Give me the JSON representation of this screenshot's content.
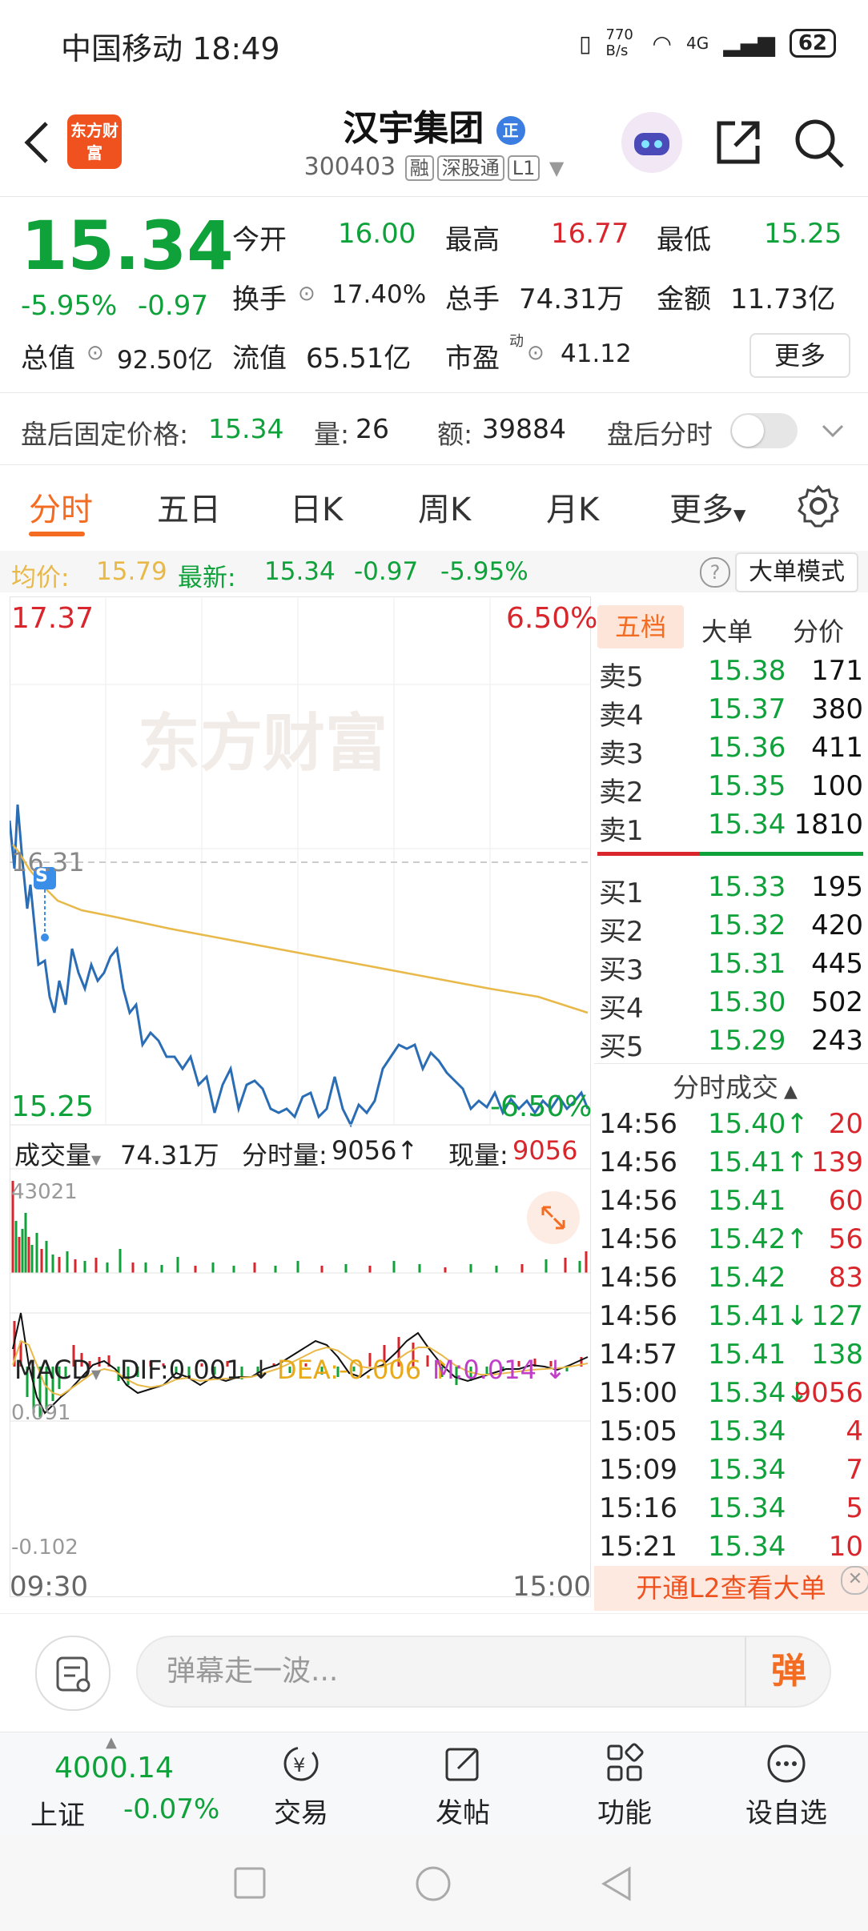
{
  "status_bar": {
    "carrier_time": "中国移动 18:49",
    "net_speed": "770 B/s",
    "network": "4G",
    "battery": "62"
  },
  "header": {
    "app_logo_text": "东方财富",
    "stock_name": "汉宇集团",
    "name_badge": "正",
    "stock_code": "300403",
    "tags": [
      "融",
      "深股通",
      "L1"
    ]
  },
  "quote": {
    "price": "15.34",
    "change_pct": "-5.95%",
    "change": "-0.97",
    "open_label": "今开",
    "open": "16.00",
    "high_label": "最高",
    "high": "16.77",
    "low_label": "最低",
    "low": "15.25",
    "turnover_label": "换手",
    "turnover": "17.40%",
    "volume_label": "总手",
    "volume": "74.31万",
    "amount_label": "金额",
    "amount": "11.73亿",
    "total_value_label": "总值",
    "total_value": "92.50亿",
    "float_value_label": "流值",
    "float_value": "65.51亿",
    "pe_label": "市盈",
    "pe_sup": "动",
    "pe": "41.12",
    "more_button": "更多"
  },
  "after_hours": {
    "price_label": "盘后固定价格:",
    "price": "15.34",
    "volume_label": "量:",
    "volume": "26",
    "amount_label": "额:",
    "amount": "39884",
    "timeshare_label": "盘后分时"
  },
  "tabs": [
    "分时",
    "五日",
    "日K",
    "周K",
    "月K",
    "更多"
  ],
  "info_bar": {
    "avg_label": "均价:",
    "avg": "15.79",
    "latest_label": "最新:",
    "latest": "15.34",
    "change": "-0.97",
    "change_pct": "-5.95%",
    "big_order_mode": "大单模式"
  },
  "price_chart": {
    "top_price": "17.37",
    "top_pct": "6.50%",
    "bottom_price": "15.25",
    "bottom_pct": "-6.50%",
    "ref_price": "16.31",
    "marker": "S",
    "watermark": "东方财富"
  },
  "volume_bar": {
    "label": "成交量",
    "total": "74.31万",
    "tick_label": "分时量:",
    "tick_value": "9056↑",
    "current_label": "现量:",
    "current_value": "9056",
    "max": "43021"
  },
  "macd_bar": {
    "label": "MACD",
    "dif": "DIF:0.001 ↓",
    "dea": "DEA:-0.006 ↑",
    "m": "M:0.014 ↓",
    "top": "0.091",
    "bottom": "-0.102"
  },
  "time_axis": {
    "start": "09:30",
    "end": "15:00"
  },
  "order_book": {
    "tabs": [
      "五档",
      "大单",
      "分价"
    ],
    "sell": [
      {
        "label": "卖5",
        "price": "15.38",
        "vol": "171"
      },
      {
        "label": "卖4",
        "price": "15.37",
        "vol": "380"
      },
      {
        "label": "卖3",
        "price": "15.36",
        "vol": "411"
      },
      {
        "label": "卖2",
        "price": "15.35",
        "vol": "100"
      },
      {
        "label": "卖1",
        "price": "15.34",
        "vol": "1810"
      }
    ],
    "buy": [
      {
        "label": "买1",
        "price": "15.33",
        "vol": "195"
      },
      {
        "label": "买2",
        "price": "15.32",
        "vol": "420"
      },
      {
        "label": "买3",
        "price": "15.31",
        "vol": "445"
      },
      {
        "label": "买4",
        "price": "15.30",
        "vol": "502"
      },
      {
        "label": "买5",
        "price": "15.29",
        "vol": "243"
      }
    ]
  },
  "ticks": {
    "title": "分时成交",
    "rows": [
      {
        "time": "14:56",
        "price": "15.40↑",
        "vol": "20"
      },
      {
        "time": "14:56",
        "price": "15.41↑",
        "vol": "139"
      },
      {
        "time": "14:56",
        "price": "15.41",
        "vol": "60"
      },
      {
        "time": "14:56",
        "price": "15.42↑",
        "vol": "56"
      },
      {
        "time": "14:56",
        "price": "15.42",
        "vol": "83"
      },
      {
        "time": "14:56",
        "price": "15.41↓",
        "vol": "127"
      },
      {
        "time": "14:57",
        "price": "15.41",
        "vol": "138"
      },
      {
        "time": "15:00",
        "price": "15.34↓",
        "vol": "9056"
      },
      {
        "time": "15:05",
        "price": "15.34",
        "vol": "4"
      },
      {
        "time": "15:09",
        "price": "15.34",
        "vol": "7"
      },
      {
        "time": "15:16",
        "price": "15.34",
        "vol": "5"
      },
      {
        "time": "15:21",
        "price": "15.34",
        "vol": "10"
      }
    ]
  },
  "l2_banner": "开通L2查看大单",
  "danmu": {
    "placeholder": "弹幕走一波...",
    "send": "弹"
  },
  "bottom_nav": {
    "index_value": "4000.14",
    "index_name": "上证",
    "index_change": "-0.07%",
    "items": [
      "交易",
      "发帖",
      "功能",
      "设自选"
    ]
  },
  "colors": {
    "up": "#d8262c",
    "down": "#0fa13a",
    "accent": "#f36c21",
    "avg_line": "#e8b949",
    "price_line": "#2a6db5"
  }
}
